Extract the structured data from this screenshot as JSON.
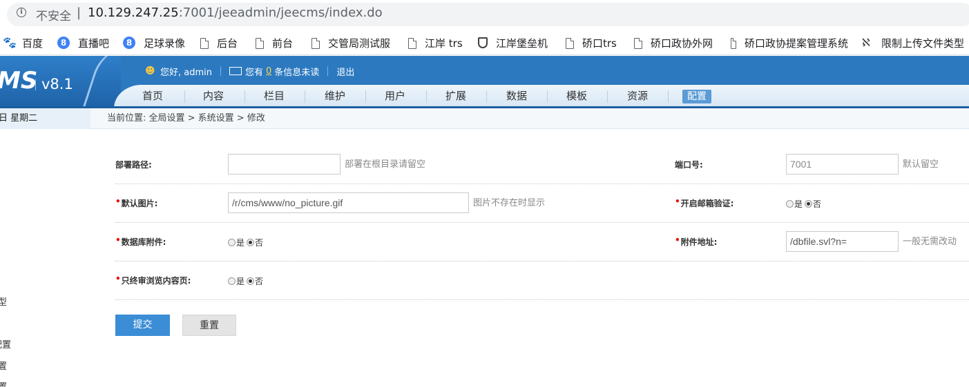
{
  "browser": {
    "security_label": "不安全",
    "url_host": "10.129.247.25",
    "url_rest": ":7001/jeeadmin/jeecms/index.do"
  },
  "bookmarks": [
    {
      "label": "百度",
      "icon": "baidu-paw-icon"
    },
    {
      "label": "直播吧",
      "icon": "circle-8-icon"
    },
    {
      "label": "足球录像",
      "icon": "circle-8-icon"
    },
    {
      "label": "后台",
      "icon": "page-icon"
    },
    {
      "label": "前台",
      "icon": "page-icon"
    },
    {
      "label": "交管局测试服",
      "icon": "page-icon"
    },
    {
      "label": "江岸 trs",
      "icon": "page-icon"
    },
    {
      "label": "江岸堡垒机",
      "icon": "shield-icon"
    },
    {
      "label": "硚口trs",
      "icon": "page-icon"
    },
    {
      "label": "硚口政协外网",
      "icon": "page-icon"
    },
    {
      "label": "硚口政协提案管理系统",
      "icon": "page-icon"
    },
    {
      "label": "限制上传文件类型",
      "icon": "bookmark-symbol-icon"
    }
  ],
  "cms": {
    "logo": "MS",
    "version": "v8.1",
    "greeting": "您好, admin",
    "msg_prefix": "您有",
    "msg_count": "0",
    "msg_suffix": "条信息未读",
    "logout": "退出",
    "nav": [
      "首页",
      "内容",
      "栏目",
      "维护",
      "用户",
      "扩展",
      "数据",
      "模板",
      "资源",
      "配置"
    ],
    "active_nav": "配置"
  },
  "sidebar": {
    "date": "日 星期二",
    "items": [
      "型",
      "配置",
      "置",
      "置"
    ]
  },
  "breadcrumb": "当前位置: 全局设置 > 系统设置 > 修改",
  "form": {
    "deploy_path": {
      "label": "部署路径:",
      "value": "",
      "hint": "部署在根目录请留空"
    },
    "port": {
      "label": "端口号:",
      "value": "7001",
      "hint": "默认留空"
    },
    "default_image": {
      "label": "默认图片:",
      "value": "/r/cms/www/no_picture.gif",
      "hint": "图片不存在时显示"
    },
    "email_verify": {
      "label": "开启邮箱验证:",
      "yes": "是",
      "no": "否",
      "selected": "否"
    },
    "db_attachment": {
      "label": "数据库附件:",
      "yes": "是",
      "no": "否",
      "selected": "否"
    },
    "attachment_url": {
      "label": "附件地址:",
      "value": "/dbfile.svl?n=",
      "hint": "一般无需改动"
    },
    "final_review_browse": {
      "label": "只终审浏览内容页:",
      "yes": "是",
      "no": "否",
      "selected": "否"
    },
    "submit": "提交",
    "reset": "重置"
  }
}
